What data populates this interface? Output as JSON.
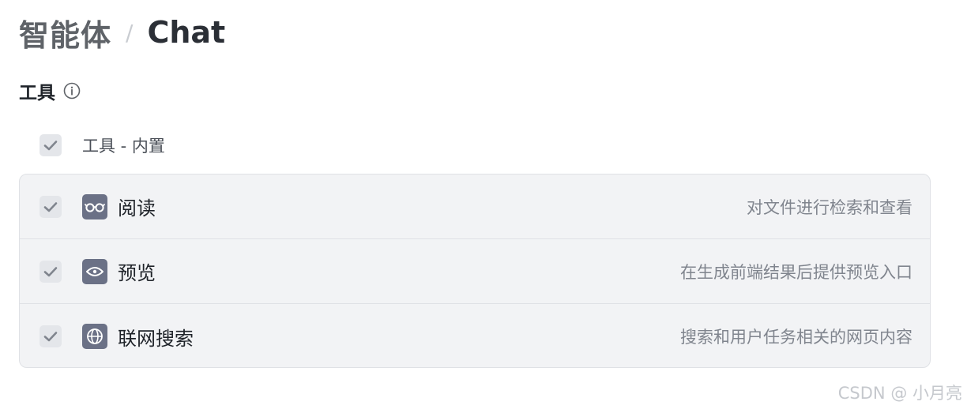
{
  "breadcrumb": {
    "parent": "智能体",
    "separator": "/",
    "current": "Chat"
  },
  "section": {
    "title": "工具",
    "info_icon": "info-circle-icon"
  },
  "group": {
    "label": "工具 - 内置",
    "checked": true
  },
  "tools": [
    {
      "name": "阅读",
      "description": "对文件进行检索和查看",
      "icon": "glasses-icon",
      "checked": true
    },
    {
      "name": "预览",
      "description": "在生成前端结果后提供预览入口",
      "icon": "eye-icon",
      "checked": true
    },
    {
      "name": "联网搜索",
      "description": "搜索和用户任务相关的网页内容",
      "icon": "globe-icon",
      "checked": true
    }
  ],
  "watermark": "CSDN @ 小月亮",
  "colors": {
    "checkbox_bg": "#e4e6ea",
    "checkmark": "#80858e",
    "icon_bg": "#6b7186",
    "panel_bg": "#f2f3f5"
  }
}
